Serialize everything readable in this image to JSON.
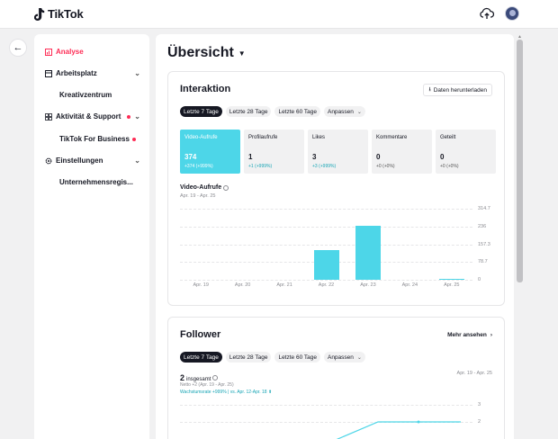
{
  "app": {
    "brand": "TikTok"
  },
  "sidebar": {
    "analyse": "Analyse",
    "arbeitsplatz": "Arbeitsplatz",
    "kreativzentrum": "Kreativzentrum",
    "aktivitaet": "Aktivität & Support",
    "tiktok_business": "TikTok For Business",
    "einstellungen": "Einstellungen",
    "unternehmensregister": "Unternehmensregis..."
  },
  "main": {
    "title": "Übersicht",
    "interaktion": {
      "title": "Interaktion",
      "download_label": "Daten herunterladen",
      "ranges": [
        "Letzte 7 Tage",
        "Letzte 28 Tage",
        "Letzte 60 Tage"
      ],
      "custom_label": "Anpassen",
      "metrics": [
        {
          "label": "Video-Aufrufe",
          "value": "374",
          "change": "+374 (+999%)"
        },
        {
          "label": "Profilaufrufe",
          "value": "1",
          "change": "+1 (+999%)"
        },
        {
          "label": "Likes",
          "value": "3",
          "change": "+3 (+999%)"
        },
        {
          "label": "Kommentare",
          "value": "0",
          "change": "+0 (+0%)"
        },
        {
          "label": "Geteilt",
          "value": "0",
          "change": "+0 (+0%)"
        }
      ],
      "chart_title": "Video-Aufrufe",
      "chart_range": "Apr. 19 - Apr. 25"
    },
    "follower": {
      "title": "Follower",
      "more_label": "Mehr ansehen",
      "ranges": [
        "Letzte 7 Tage",
        "Letzte 28 Tage",
        "Letzte 60 Tage"
      ],
      "custom_label": "Anpassen",
      "total_value": "2",
      "total_label": "insgesamt",
      "net_text": "Netto +2 (Apr. 19 - Apr. 25)",
      "growth_text": "Wachstumsrate +999% | vs. Apr. 12-Apr. 18 ⬆",
      "range_right": "Apr. 19 - Apr. 25",
      "yticks": [
        "3",
        "2"
      ]
    }
  },
  "chart_data": {
    "type": "bar",
    "title": "Video-Aufrufe",
    "subtitle": "Apr. 19 - Apr. 25",
    "categories": [
      "Apr. 19",
      "Apr. 20",
      "Apr. 21",
      "Apr. 22",
      "Apr. 23",
      "Apr. 24",
      "Apr. 25"
    ],
    "values": [
      0,
      0,
      0,
      131,
      241,
      0,
      2
    ],
    "y_ticks": [
      "0",
      "78.7",
      "157.3",
      "236",
      "314.7"
    ],
    "ylim": [
      0,
      314.7
    ],
    "color": "#4dd6e8"
  },
  "colors": {
    "accent": "#fe2c55",
    "cyan": "#4dd6e8",
    "dark": "#161823"
  }
}
